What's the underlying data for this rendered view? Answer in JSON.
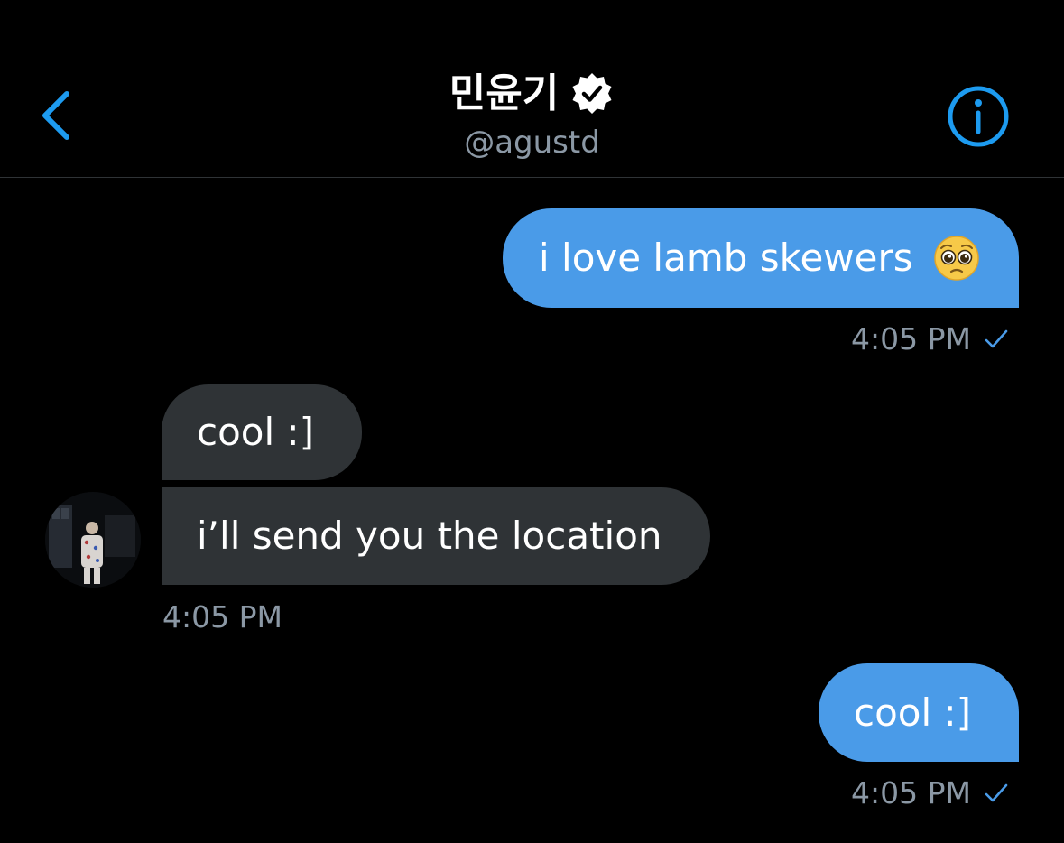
{
  "header": {
    "name": "민윤기",
    "handle": "@agustd",
    "back_icon": "chevron-left-icon",
    "verified_icon": "verified-badge-icon",
    "info_icon": "info-icon"
  },
  "messages": [
    {
      "direction": "out",
      "text": "i love lamb skewers",
      "emoji": "pleading-face-icon",
      "time": "4:05 PM",
      "read_icon": "checkmark-icon"
    },
    {
      "direction": "in",
      "text": "cool :]"
    },
    {
      "direction": "in",
      "text": "i’ll send you the location",
      "time": "4:05 PM"
    },
    {
      "direction": "out",
      "text": "cool :]",
      "time": "4:05 PM",
      "read_icon": "checkmark-icon"
    }
  ],
  "colors": {
    "background": "#000000",
    "accent": "#1d9bf0",
    "outgoing_bubble": "#4a9be8",
    "incoming_bubble": "#2f3336",
    "secondary_text": "#8b98a5"
  }
}
